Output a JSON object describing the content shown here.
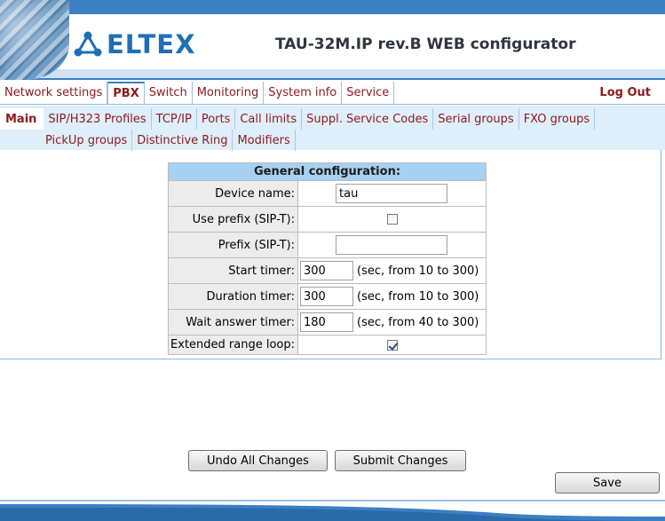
{
  "app": {
    "brand": "ELTEX",
    "title": "TAU-32M.IP rev.B WEB configurator",
    "colors": {
      "accent": "#3b7fc4",
      "link": "#8b1a1a",
      "subnav_bg": "#dfeefb",
      "table_header": "#a8d0f0"
    }
  },
  "main_tabs": [
    {
      "label": "Network settings",
      "active": false
    },
    {
      "label": "PBX",
      "active": true
    },
    {
      "label": "Switch",
      "active": false
    },
    {
      "label": "Monitoring",
      "active": false
    },
    {
      "label": "System info",
      "active": false
    },
    {
      "label": "Service",
      "active": false
    }
  ],
  "logout_label": "Log Out",
  "sub_tabs": {
    "row1": [
      {
        "label": "Main",
        "active": true
      },
      {
        "label": "SIP/H323 Profiles"
      },
      {
        "label": "TCP/IP"
      },
      {
        "label": "Ports"
      },
      {
        "label": "Call limits"
      },
      {
        "label": "Suppl. Service Codes"
      },
      {
        "label": "Serial groups"
      },
      {
        "label": "FXO groups"
      }
    ],
    "row2": [
      {
        "label": "PickUp groups"
      },
      {
        "label": "Distinctive Ring"
      },
      {
        "label": "Modifiers"
      }
    ]
  },
  "config": {
    "title": "General configuration:",
    "device_name": {
      "label": "Device name:",
      "value": "tau"
    },
    "use_prefix": {
      "label": "Use prefix (SIP-T):",
      "checked": false
    },
    "prefix": {
      "label": "Prefix (SIP-T):",
      "value": ""
    },
    "start_timer": {
      "label": "Start timer:",
      "value": "300",
      "hint": "(sec, from 10 to 300)"
    },
    "duration_timer": {
      "label": "Duration timer:",
      "value": "300",
      "hint": "(sec, from 10 to 300)"
    },
    "wait_answer_timer": {
      "label": "Wait answer timer:",
      "value": "180",
      "hint": "(sec, from 40 to 300)"
    },
    "extended_range_loop": {
      "label": "Extended range loop:",
      "checked": true
    }
  },
  "buttons": {
    "undo": "Undo All Changes",
    "submit": "Submit Changes",
    "save": "Save"
  }
}
